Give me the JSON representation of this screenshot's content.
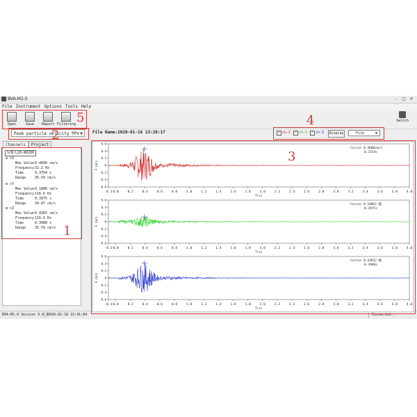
{
  "window": {
    "title": "BVA-M2.0",
    "min": "–",
    "max": "□",
    "close": "✕"
  },
  "menu": [
    "File",
    "Instrument",
    "Options",
    "Tools",
    "Help"
  ],
  "toolbar": {
    "items": [
      {
        "label": "Open",
        "icon": "folder-open-icon"
      },
      {
        "label": "Save",
        "icon": "save-icon"
      },
      {
        "label": "Report",
        "icon": "report-icon"
      },
      {
        "label": "Filtering",
        "icon": "filter-icon"
      }
    ],
    "switch_label": "Switch"
  },
  "annotations": [
    "1",
    "2",
    "3",
    "4",
    "5"
  ],
  "left": {
    "select_value": "Peak particle velocity PPV",
    "tabs": [
      "Channels",
      "Project"
    ],
    "serial": "S/N:L20-N0286",
    "channels": [
      {
        "name": "cX",
        "rows": [
          [
            "Max Value",
            "0.4600 cm/s"
          ],
          [
            "Frequency",
            "32.2 Hz"
          ],
          [
            "Time",
            "0.3754 s"
          ],
          [
            "Range",
            "35.59 cm/s"
          ]
        ]
      },
      {
        "name": "cY",
        "rows": [
          [
            "Max Value",
            "0.1886 cm/s"
          ],
          [
            "Frequency",
            "116.6 Hz"
          ],
          [
            "Time",
            "0.3975 s"
          ],
          [
            "Range",
            "34.87 cm/s"
          ]
        ]
      },
      {
        "name": "cZ",
        "rows": [
          [
            "Max Value",
            "0.4365 cm/s"
          ],
          [
            "Frequency",
            "116.6 Hz"
          ],
          [
            "Time",
            "0.3988 s"
          ],
          [
            "Range",
            "35.59 cm/s"
          ]
        ]
      }
    ]
  },
  "header": {
    "file_name": "File Name:2020-01-16 13:28:17",
    "checks": [
      "ch-X",
      "ch-Y",
      "ch-Z"
    ],
    "display_label": "Display",
    "file_select": "File"
  },
  "plots": {
    "ylabel": "V cm/s",
    "xlabel": "T(s)",
    "panels": [
      {
        "color": "#cc2222",
        "cursor": "Cursor 0.4600cm/s",
        "cursor_time": "0.3754s"
      },
      {
        "color": "#22cc22",
        "cursor": "Cursor 0.18862 极",
        "cursor_time": "0.3975s"
      },
      {
        "color": "#2233cc",
        "cursor": "Cursor 0.43652 极",
        "cursor_time": "0.3988s"
      }
    ],
    "yticks": [
      "0.6",
      "0.4",
      "0.2",
      "0",
      "-0.2",
      "-0.4",
      "-0.6"
    ],
    "xticks": [
      "-0.1",
      "0.0",
      "0.2",
      "0.4",
      "0.6",
      "0.8",
      "1.0",
      "1.2",
      "1.4",
      "1.6",
      "1.8",
      "2.0",
      "2.2",
      "2.4",
      "2.6",
      "2.8",
      "3.0",
      "3.2",
      "3.4",
      "3.6",
      "3.8",
      "4.0"
    ]
  },
  "status": {
    "version": "BVA-M2.0 Version 3.0.3",
    "time": "2020-02-18 15:41:04",
    "connection": "Connected..."
  }
}
